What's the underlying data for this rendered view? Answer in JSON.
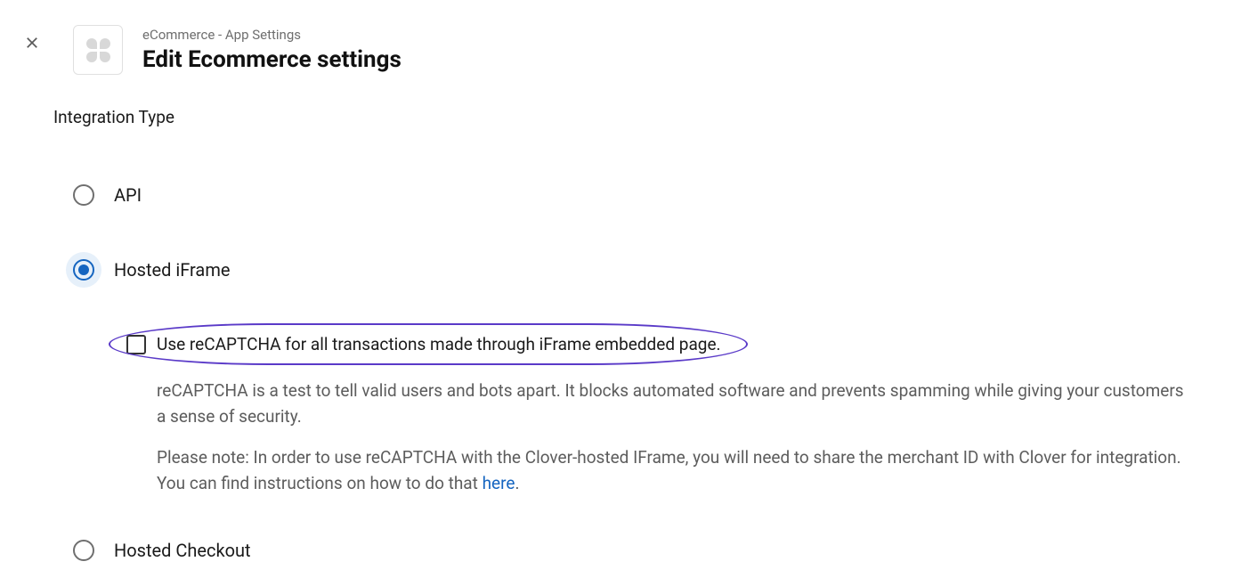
{
  "header": {
    "breadcrumb": "eCommerce - App Settings",
    "title": "Edit Ecommerce settings"
  },
  "section": {
    "title": "Integration Type"
  },
  "options": {
    "api": {
      "label": "API",
      "selected": false
    },
    "hosted_iframe": {
      "label": "Hosted iFrame",
      "selected": true
    },
    "hosted_checkout": {
      "label": "Hosted Checkout",
      "selected": false
    }
  },
  "recaptcha": {
    "checkbox_label": "Use reCAPTCHA for all transactions made through iFrame embedded page.",
    "checked": false,
    "help1": "reCAPTCHA is a test to tell valid users and bots apart. It blocks automated software and prevents spamming while giving your customers a sense of security.",
    "help2_prefix": "Please note: In order to use reCAPTCHA with the Clover-hosted IFrame, you will need to share the merchant ID with Clover for integration. You can find instructions on how to do that ",
    "help2_link": "here",
    "help2_suffix": "."
  }
}
